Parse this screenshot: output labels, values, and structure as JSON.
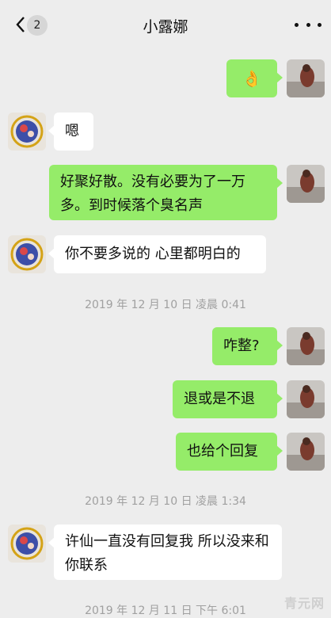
{
  "header": {
    "back_glyph": "<",
    "unread_count": "2",
    "title": "小露娜",
    "more_label": "•••"
  },
  "messages": [
    {
      "side": "out",
      "text": "👌"
    },
    {
      "side": "in",
      "text": "嗯"
    },
    {
      "side": "out",
      "text": "好聚好散。没有必要为了一万多。到时候落个臭名声"
    },
    {
      "side": "in",
      "text": "你不要多说的 心里都明白的"
    },
    {
      "side": "out",
      "text": "咋整?"
    },
    {
      "side": "out",
      "text": "退或是不退"
    },
    {
      "side": "out",
      "text": "也给个回复"
    },
    {
      "side": "in",
      "text": "许仙一直没有回复我 所以没来和你联系"
    }
  ],
  "timestamps": [
    "2019 年 12 月 10 日 凌晨 0:41",
    "2019 年 12 月 10 日 凌晨 1:34",
    "2019 年 12 月 11 日 下午 6:01"
  ],
  "watermark": "青元网",
  "colors": {
    "background": "#ededed",
    "sent_bubble": "#95ec69",
    "received_bubble": "#ffffff",
    "timestamp_text": "#a0a0a0"
  }
}
